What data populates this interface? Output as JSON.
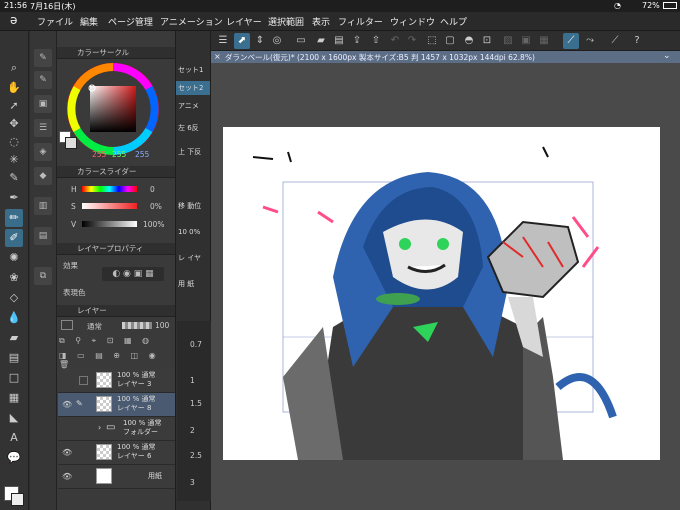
{
  "status": {
    "time": "21:56",
    "date": "7月16日(木)",
    "battery": "72%"
  },
  "menu": [
    "ファイル",
    "編集",
    "ページ管理",
    "アニメーション",
    "レイヤー",
    "選択範囲",
    "表示",
    "フィルター",
    "ウィンドウ",
    "ヘルプ"
  ],
  "color_circle": {
    "title": "カラーサークル",
    "r": "255",
    "g": "255",
    "b": "255"
  },
  "color_slider": {
    "title": "カラースライダー",
    "h_label": "H",
    "h_val": "0",
    "s_label": "S",
    "s_val": "0%",
    "v_label": "V",
    "v_val": "100%"
  },
  "layer_prop": {
    "title": "レイヤープロパティ",
    "effect": "効果",
    "expr_color": "表現色"
  },
  "layers": {
    "title": "レイヤー",
    "blend": "通常",
    "opacity": "100",
    "items": [
      {
        "pct": "100 %",
        "mode": "通常",
        "name": "レイヤー 3"
      },
      {
        "pct": "100 %",
        "mode": "通常",
        "name": "レイヤー 8"
      },
      {
        "pct": "100 %",
        "mode": "通常",
        "name": "フォルダー"
      },
      {
        "pct": "100 %",
        "mode": "通常",
        "name": "レイヤー 6"
      },
      {
        "pct": "",
        "mode": "",
        "name": "用紙"
      }
    ]
  },
  "sets": [
    "セット1",
    "セット2",
    "アニメ"
  ],
  "side_labels": [
    "左 6反",
    "上 下反",
    "移 動位",
    "10 0%",
    "レ イヤ",
    "用 紙"
  ],
  "brush_sizes": [
    "0.7",
    "1",
    "1.5",
    "2",
    "2.5",
    "3"
  ],
  "doc_title": "ダランベール(復元)* (2100 x 1600px 製本サイズ:B5 判 1457 x 1032px 144dpi 62.8%)",
  "colors": {
    "accent": "#3b6f8f",
    "tab": "#5c6e86",
    "canvas": "#ffffff",
    "hair": "#2f63b0",
    "green": "#2ed35a"
  }
}
